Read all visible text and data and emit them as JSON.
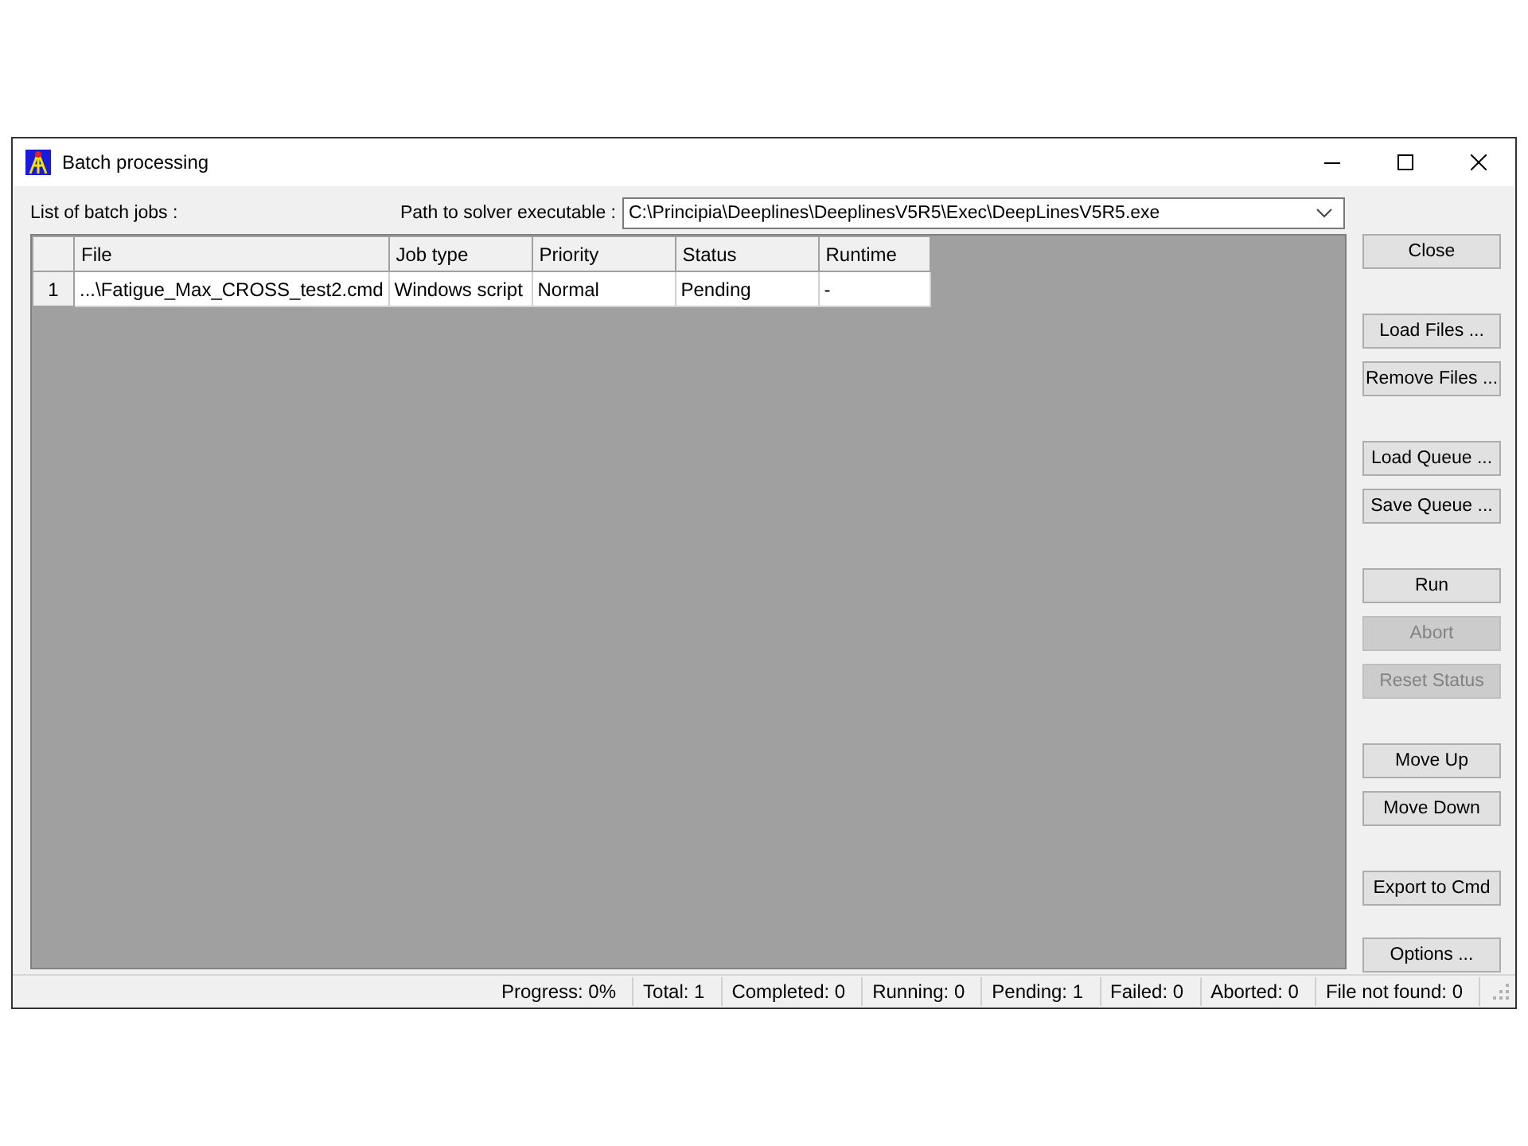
{
  "window": {
    "title": "Batch processing"
  },
  "list_label": "List of batch jobs :",
  "solver_path": {
    "label": "Path to solver executable :",
    "value": "C:\\Principia\\Deeplines\\DeeplinesV5R5\\Exec\\DeepLinesV5R5.exe"
  },
  "table": {
    "columns": [
      "File",
      "Job type",
      "Priority",
      "Status",
      "Runtime"
    ],
    "rows": [
      {
        "number": "1",
        "cells": [
          "...\\Fatigue_Max_CROSS_test2.cmd",
          "Windows script",
          "Normal",
          "Pending",
          "-"
        ]
      }
    ]
  },
  "button_groups": [
    [
      {
        "label": "Close",
        "disabled": false
      }
    ],
    [
      {
        "label": "Load Files ...",
        "disabled": false
      },
      {
        "label": "Remove Files ...",
        "disabled": false
      }
    ],
    [
      {
        "label": "Load Queue ...",
        "disabled": false
      },
      {
        "label": "Save Queue ...",
        "disabled": false
      }
    ],
    [
      {
        "label": "Run",
        "disabled": false
      },
      {
        "label": "Abort",
        "disabled": true
      },
      {
        "label": "Reset Status",
        "disabled": true
      }
    ],
    [
      {
        "label": "Move Up",
        "disabled": false
      },
      {
        "label": "Move Down",
        "disabled": false
      }
    ],
    [
      {
        "label": "Export to Cmd",
        "disabled": false
      }
    ],
    [
      {
        "label": "Options ...",
        "disabled": false
      }
    ]
  ],
  "status_bar": [
    "Progress: 0%",
    "Total: 1",
    "Completed: 0",
    "Running: 0",
    "Pending: 1",
    "Failed: 0",
    "Aborted: 0",
    "File not found: 0"
  ]
}
